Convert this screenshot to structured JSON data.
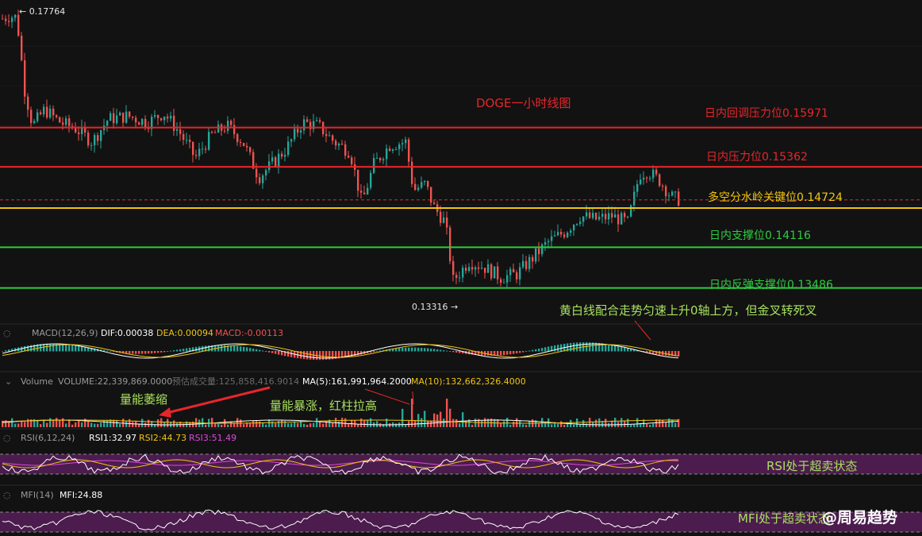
{
  "chart_data": {
    "type": "candlestick",
    "title": "DOGE一小时线图",
    "price_range": [
      0.1305,
      0.1785
    ],
    "high_marker": "← 0.17764",
    "low_marker": "0.13316 →",
    "levels": [
      {
        "label": "日内回调压力位0.15971",
        "value": 0.15971,
        "color": "#e8262a"
      },
      {
        "label": "日内压力位0.15362",
        "value": 0.15362,
        "color": "#e8262a"
      },
      {
        "label": "多空分水岭关键位0.14724",
        "value": 0.14724,
        "color": "#f1c40f"
      },
      {
        "label": "日内支撑位0.14116",
        "value": 0.14116,
        "color": "#2ecc40"
      },
      {
        "label": "日内反弹支撑位0.13486",
        "value": 0.13486,
        "color": "#2ecc40"
      }
    ],
    "current_price_line": 0.1485,
    "price_path": [
      [
        0,
        0.1765
      ],
      [
        10,
        0.177
      ],
      [
        20,
        0.1768
      ],
      [
        30,
        0.1655
      ],
      [
        40,
        0.16
      ],
      [
        55,
        0.1625
      ],
      [
        75,
        0.1605
      ],
      [
        95,
        0.1595
      ],
      [
        115,
        0.1575
      ],
      [
        135,
        0.161
      ],
      [
        160,
        0.1615
      ],
      [
        185,
        0.1605
      ],
      [
        205,
        0.162
      ],
      [
        225,
        0.159
      ],
      [
        245,
        0.155
      ],
      [
        265,
        0.1585
      ],
      [
        285,
        0.16
      ],
      [
        305,
        0.1575
      ],
      [
        325,
        0.152
      ],
      [
        345,
        0.1545
      ],
      [
        360,
        0.1565
      ],
      [
        380,
        0.1605
      ],
      [
        400,
        0.16
      ],
      [
        420,
        0.1575
      ],
      [
        440,
        0.156
      ],
      [
        455,
        0.148
      ],
      [
        470,
        0.154
      ],
      [
        490,
        0.157
      ],
      [
        510,
        0.1575
      ],
      [
        520,
        0.15
      ],
      [
        535,
        0.151
      ],
      [
        545,
        0.1475
      ],
      [
        560,
        0.145
      ],
      [
        570,
        0.136
      ],
      [
        590,
        0.139
      ],
      [
        610,
        0.138
      ],
      [
        630,
        0.1365
      ],
      [
        650,
        0.137
      ],
      [
        670,
        0.1395
      ],
      [
        690,
        0.142
      ],
      [
        710,
        0.1435
      ],
      [
        730,
        0.146
      ],
      [
        750,
        0.1455
      ],
      [
        770,
        0.146
      ],
      [
        790,
        0.145
      ],
      [
        805,
        0.1525
      ],
      [
        815,
        0.153
      ],
      [
        830,
        0.1515
      ],
      [
        845,
        0.149
      ],
      [
        855,
        0.1485
      ]
    ],
    "annotation": "黄白线配合走势匀速上升0轴上方，但金叉转死叉",
    "macd": {
      "title": "MACD(12,26,9)",
      "dif": "DIF:0.00038",
      "dea": "DEA:0.00094",
      "macd": "MACD:-0.00113"
    },
    "volume": {
      "title": "Volume",
      "volume": "VOLUME:22,339,869.0000",
      "estimate": "预估成交量:125,858,416.9014",
      "ma5": "MA(5):161,991,964.2000",
      "ma10": "MA(10):132,662,326.4000",
      "notes": [
        "量能萎缩",
        "量能暴涨，红柱拉高"
      ]
    },
    "rsi": {
      "title": "RSI(6,12,24)",
      "rsi1": "RSI1:32.97",
      "rsi2": "RSI2:44.73",
      "rsi3": "RSI3:51.49",
      "note": "RSI处于超卖状态"
    },
    "mfi": {
      "title": "MFI(14)",
      "mfi": "MFI:24.88",
      "note": "MFI处于超卖状态"
    }
  },
  "watermark": "@周易趋势",
  "colors": {
    "up": "#26a69a",
    "down": "#ef5350",
    "rsi_band": "#5b1f5e"
  }
}
